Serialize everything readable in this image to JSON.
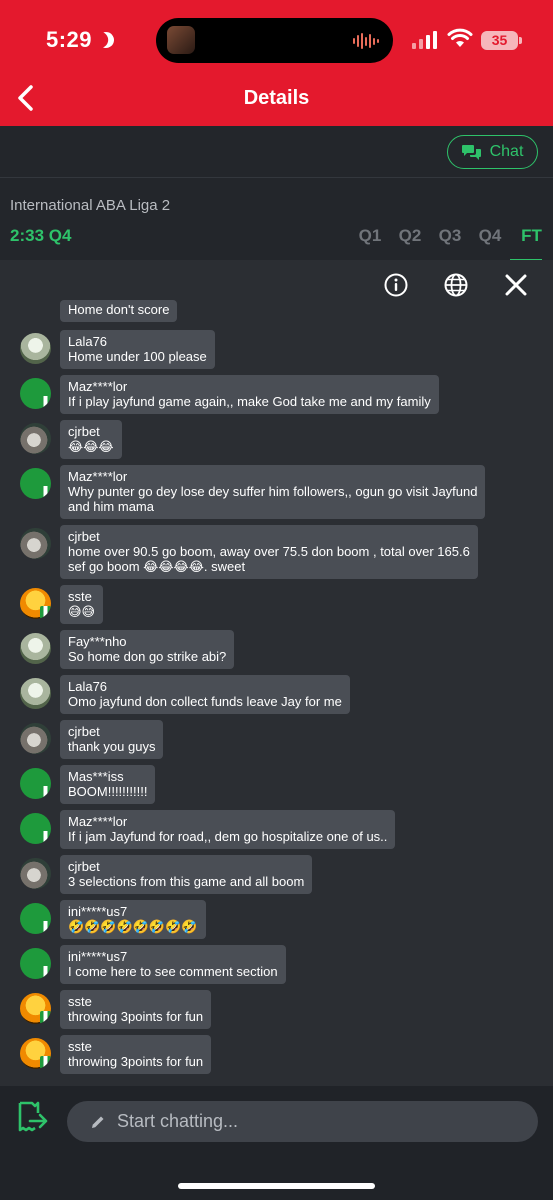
{
  "status_bar": {
    "time": "5:29",
    "battery": "35"
  },
  "header": {
    "title": "Details"
  },
  "chat_button": {
    "label": "Chat"
  },
  "match": {
    "league": "International ABA Liga 2",
    "clock": "2:33 Q4",
    "periods": [
      "Q1",
      "Q2",
      "Q3",
      "Q4",
      "FT"
    ],
    "active_period": "FT"
  },
  "messages": [
    {
      "user": "",
      "text": "Home don't score",
      "avatar": "field"
    },
    {
      "user": "Lala76",
      "text": "Home under 100 please",
      "avatar": "field"
    },
    {
      "user": "Maz****lor",
      "text": "If i play jayfund game again,, make God take me and my family",
      "avatar": "green"
    },
    {
      "user": "cjrbet",
      "text": "😂😂😂",
      "avatar": "cj"
    },
    {
      "user": "Maz****lor",
      "text": "Why punter go dey lose dey suffer him followers,, ogun go visit Jayfund",
      "text2": "and him mama",
      "avatar": "green"
    },
    {
      "user": "cjrbet",
      "text": "home over 90.5 go boom, away over 75.5 don boom , total over 165.6",
      "text2": "sef go boom 😂😂😂😂. sweet",
      "avatar": "cj"
    },
    {
      "user": "sste",
      "text": "😅😅",
      "avatar": "sun"
    },
    {
      "user": "Fay***nho",
      "text": "So home don go strike abi?",
      "avatar": "field"
    },
    {
      "user": "Lala76",
      "text": "Omo jayfund don collect funds leave Jay for me",
      "avatar": "field"
    },
    {
      "user": "cjrbet",
      "text": "thank you guys",
      "avatar": "cj"
    },
    {
      "user": "Mas***iss",
      "text": "BOOM!!!!!!!!!!!",
      "avatar": "green"
    },
    {
      "user": "Maz****lor",
      "text": "If i jam Jayfund for road,, dem go hospitalize one of us..",
      "avatar": "green"
    },
    {
      "user": "cjrbet",
      "text": "3 selections from this game and all boom",
      "avatar": "cj"
    },
    {
      "user": "ini*****us7",
      "text": "🤣🤣🤣🤣🤣🤣🤣🤣",
      "avatar": "green"
    },
    {
      "user": "ini*****us7",
      "text": "I come here to see comment section",
      "avatar": "green"
    },
    {
      "user": "sste",
      "text": "throwing 3points for fun",
      "avatar": "sun"
    },
    {
      "user": "sste",
      "text": "throwing 3points for fun",
      "avatar": "sun"
    }
  ],
  "input": {
    "placeholder": "Start chatting..."
  }
}
